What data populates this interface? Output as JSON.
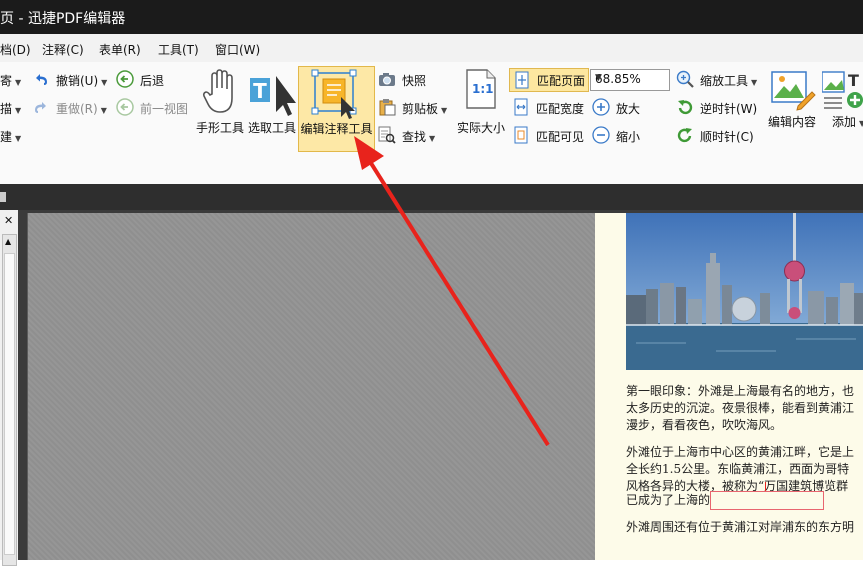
{
  "app": {
    "title": "- 迅捷PDF编辑器",
    "title_prefix": "页"
  },
  "menu": [
    "档(D)",
    "注释(C)",
    "表单(R)",
    "工具(T)",
    "窗口(W)"
  ],
  "ribbon": {
    "left_col": [
      "寄",
      "描",
      "建"
    ],
    "undo": "撤销(U)",
    "redo": "重做(R)",
    "back": "后退",
    "prev_view": "前一视图",
    "hand_tool": "手形工具",
    "select_tool": "选取工具",
    "edit_annot_tool": "编辑注释工具",
    "snapshot": "快照",
    "clipboard": "剪贴板",
    "find": "查找",
    "actual_size": "实际大小",
    "actual_size_icon": "1:1",
    "fit_page": "匹配页面",
    "fit_width": "匹配宽度",
    "fit_visible": "匹配可见",
    "zoom_value": "68.85%",
    "zoom_tool": "缩放工具",
    "zoom_in": "放大",
    "zoom_out": "缩小",
    "rotate_ccw": "逆时针(W)",
    "rotate_cw": "顺时针(C)",
    "edit_content": "编辑内容",
    "add": "添加"
  },
  "document": {
    "para1_line1": "第一眼印象：外滩是上海最有名的地方，也",
    "para1_line2": "太多历史的沉淀。夜景很棒，能看到黄浦江",
    "para1_line3": "漫步，看看夜色，吹吹海风。",
    "para2_line1": "外滩位于上海市中心区的黄浦江畔，它是上",
    "para2_line2": "全长约1.5公里。东临黄浦江，西面为哥特",
    "para2_line3": "风格各异的大楼，被称为“万国建筑博览群",
    "para2_line4": "已成为了上海的",
    "para3_line1": "外滩周围还有位于黄浦江对岸浦东的东方明"
  },
  "colors": {
    "accent_selected": "#fde8a6",
    "annotation_border": "#e8656f",
    "arrow": "#e8231c"
  }
}
